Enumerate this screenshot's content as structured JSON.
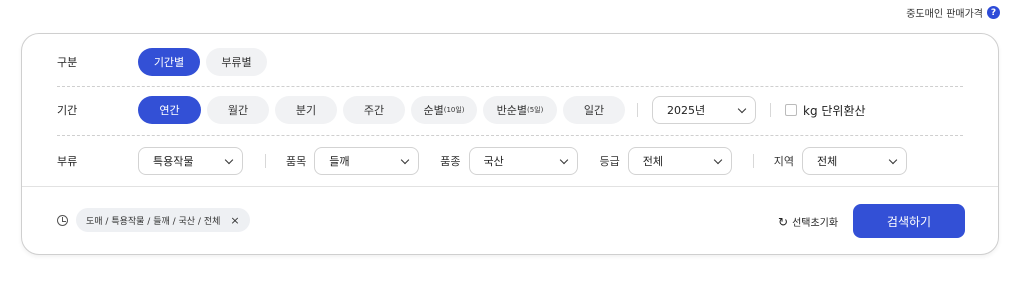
{
  "top_link": {
    "label": "중도매인 판매가격",
    "help_icon": "?"
  },
  "row_type": {
    "label": "구분",
    "options": [
      "기간별",
      "부류별"
    ]
  },
  "row_period": {
    "label": "기간",
    "options": [
      {
        "text": "연간",
        "sub": ""
      },
      {
        "text": "월간",
        "sub": ""
      },
      {
        "text": "분기",
        "sub": ""
      },
      {
        "text": "주간",
        "sub": ""
      },
      {
        "text": "순별",
        "sub": "(10일)"
      },
      {
        "text": "반순별",
        "sub": "(5일)"
      },
      {
        "text": "일간",
        "sub": ""
      }
    ],
    "year": "2025년",
    "kg_label": "kg 단위환산"
  },
  "row_category": {
    "label": "부류",
    "category_value": "특용작물",
    "item_label": "품목",
    "item_value": "들깨",
    "variety_label": "품종",
    "variety_value": "국산",
    "grade_label": "등급",
    "grade_value": "전체",
    "region_label": "지역",
    "region_value": "전체"
  },
  "history": {
    "chip_text": "도매 / 특용작물 / 들깨 / 국산 / 전체",
    "close": "×"
  },
  "actions": {
    "reset_icon": "↻",
    "reset_label": "선택초기화",
    "search_label": "검색하기"
  },
  "colors": {
    "accent": "#3350d6",
    "pill_bg": "#f1f2f4"
  }
}
